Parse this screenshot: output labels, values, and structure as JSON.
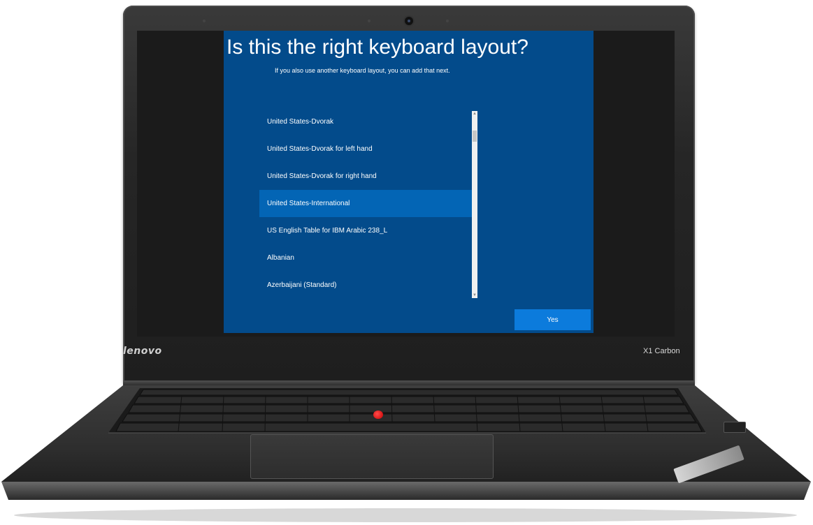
{
  "device": {
    "brand": "lenovo",
    "model": "X1 Carbon"
  },
  "setup": {
    "title": "Is this the right keyboard layout?",
    "subtitle": "If you also use another keyboard layout, you can add that next.",
    "layouts": [
      "United States-Dvorak",
      "United States-Dvorak for left hand",
      "United States-Dvorak for right hand",
      "United States-International",
      "US English Table for IBM Arabic 238_L",
      "Albanian",
      "Azerbaijani (Standard)"
    ],
    "selected_layout": "United States-International",
    "yes_label": "Yes"
  },
  "colors": {
    "background": "#034b8b",
    "selected_row": "#0365b5",
    "button": "#0c7bdc"
  }
}
